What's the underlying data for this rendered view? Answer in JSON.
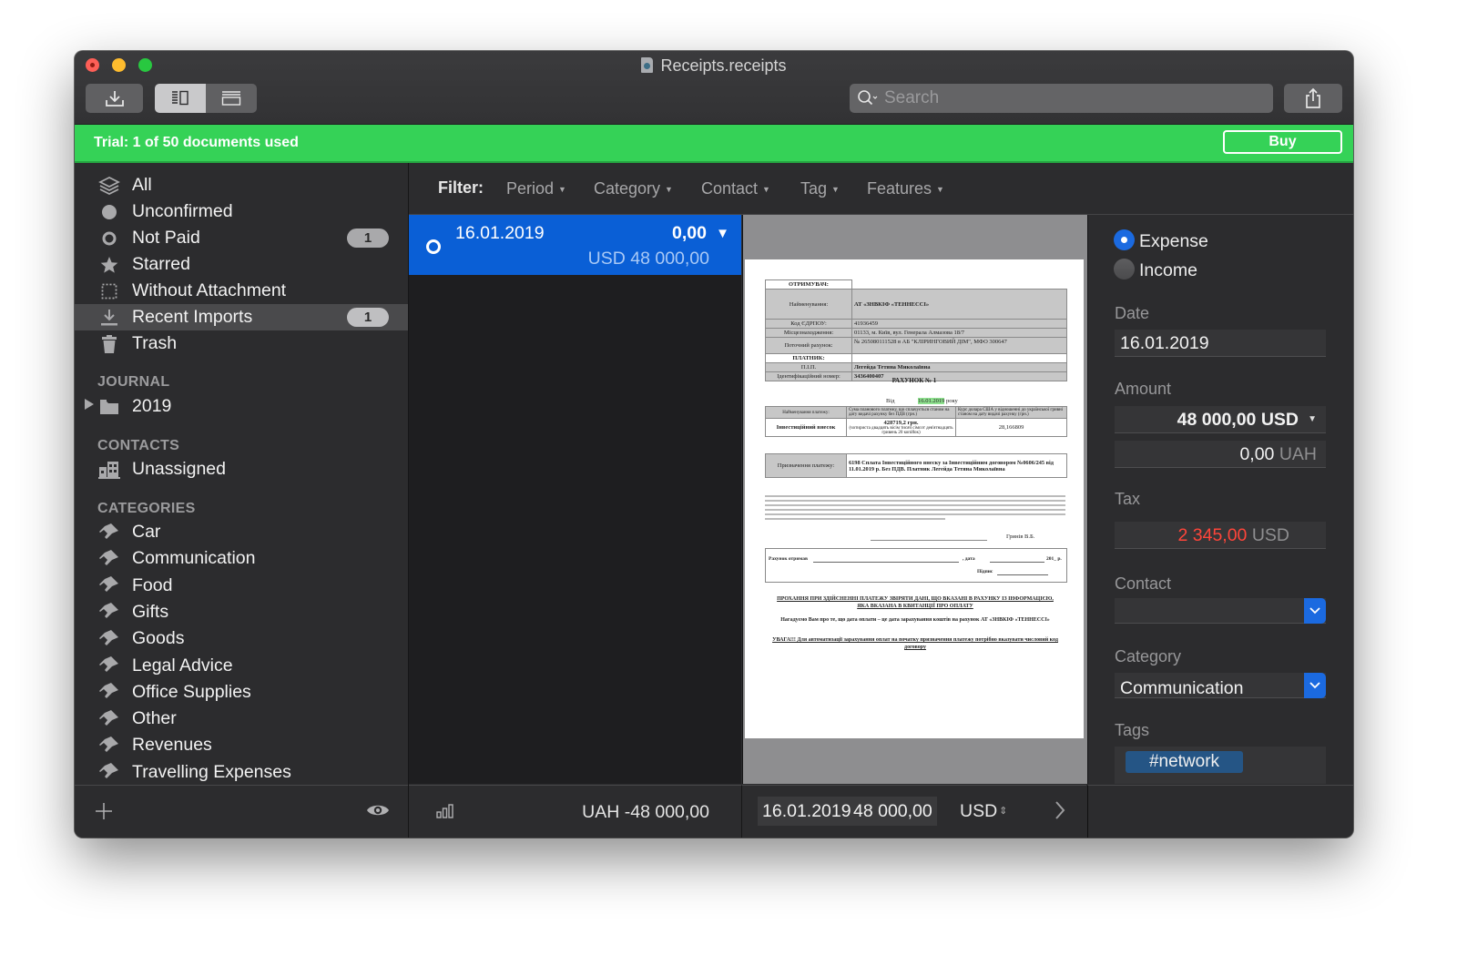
{
  "window": {
    "title": "Receipts.receipts",
    "file_icon": "receipts-document-icon"
  },
  "toolbar": {
    "import_icon": "import-icon",
    "view_modes": [
      {
        "name": "split-view-icon",
        "selected": true
      },
      {
        "name": "list-view-icon",
        "selected": false
      }
    ],
    "search_placeholder": "Search",
    "search_value": "",
    "share_icon": "share-icon"
  },
  "trial": {
    "text": "Trial: 1 of 50 documents used",
    "buy_label": "Buy",
    "color": "#35d257"
  },
  "sidebar": {
    "smart_items": [
      {
        "label": "All",
        "icon": "stack-icon",
        "badge": null,
        "selected": false
      },
      {
        "label": "Unconfirmed",
        "icon": "filled-circle-icon",
        "badge": null,
        "selected": false
      },
      {
        "label": "Not Paid",
        "icon": "open-circle-icon",
        "badge": "1",
        "selected": false
      },
      {
        "label": "Starred",
        "icon": "star-icon",
        "badge": null,
        "selected": false
      },
      {
        "label": "Without Attachment",
        "icon": "dotted-square-icon",
        "badge": null,
        "selected": false
      },
      {
        "label": "Recent Imports",
        "icon": "download-icon",
        "badge": "1",
        "selected": true
      },
      {
        "label": "Trash",
        "icon": "trash-icon",
        "badge": null,
        "selected": false
      }
    ],
    "journal_header": "JOURNAL",
    "journal_items": [
      {
        "label": "2019",
        "icon": "folder-icon",
        "expandable": true
      }
    ],
    "contacts_header": "CONTACTS",
    "contact_items": [
      {
        "label": "Unassigned",
        "icon": "building-icon"
      }
    ],
    "categories_header": "CATEGORIES",
    "categories": [
      "Car",
      "Communication",
      "Food",
      "Gifts",
      "Goods",
      "Legal Advice",
      "Office Supplies",
      "Other",
      "Revenues",
      "Travelling Expenses"
    ],
    "footer": {
      "add_icon": "plus-icon",
      "visibility_icon": "eye-icon"
    }
  },
  "filter": {
    "label": "Filter:",
    "items": [
      "Period",
      "Category",
      "Contact",
      "Tag",
      "Features"
    ]
  },
  "list": {
    "rows": [
      {
        "status": "not-paid",
        "date": "16.01.2019",
        "amount": "0,00",
        "original_amount": "USD 48 000,00",
        "selected": true
      }
    ],
    "total": "UAH -48 000,00",
    "stats_icon": "bar-chart-icon"
  },
  "preview_footer": {
    "date": "16.01.2019",
    "amount": "48 000,00",
    "currency": "USD",
    "next_icon": "chevron-right-icon"
  },
  "document": {
    "recipient_header": "ОТРИМУВАЧ:",
    "rows_recipient": [
      {
        "label": "Найменування:",
        "value": "АТ «ЗНВКІФ «ТЕННЕССІ»"
      },
      {
        "label": "Код ЄДРПОУ:",
        "value": "41936459"
      },
      {
        "label": "Місцезнаходження:",
        "value": "01133, м. Київ, вул. Генерала Алмазова 18/7"
      },
      {
        "label": "Поточний рахунок:",
        "value": "№ 265080111528 в АБ \"КЛІРИНГОВИЙ ДІМ\", МФО 300647"
      }
    ],
    "payer_header": "ПЛАТНИК:",
    "rows_payer": [
      {
        "label": "П.І.П.",
        "value": "Легейда Тетяна Миколаївна"
      },
      {
        "label": "Ідентифікаційний номер:",
        "value": "3436400407"
      }
    ],
    "invoice_title": "РАХУНОК № 1",
    "from_label": "Від",
    "from_date": "16.01.2019",
    "from_suffix": "року",
    "pay_table": {
      "headers": [
        "Найменування платежу:",
        "Сума планового платежу, що сплачується станом на дату видачі рахунку без ПДВ (грн.)",
        "Курс долара США у відношенні до української гривні станом на дату видачі рахунку (грн.)"
      ],
      "row": [
        "Інвестиційний внесок",
        "428719,2 грн.",
        "28,166809"
      ],
      "amount_words": "(чотириста двадцять вісім тисяч сімсот дев'ятнадцять гривень 20 копійок)"
    },
    "purpose_label": "Призначення платежу:",
    "purpose_value": "6198 Сплата Інвестиційного внеску за Інвестиційним договором №0606/245 від 11.01.2019 р. Без ПДВ. Платник Легейда Тетяна Миколаївна",
    "signatory": "Гринів В.Б.",
    "received_label": "Рахунок отримав",
    "date_label": ", дата",
    "year_suffix": "201_ р.",
    "sign_label": "Підпис",
    "notice_1": "ПРОХАННЯ ПРИ ЗДІЙСНЕННІ ПЛАТЕЖУ ЗВІРЯТИ ДАНІ, ЩО ВКАЗАНІ В РАХУНКУ ІЗ ІНФОРМАЦІЄЮ, ЯКА ВКАЗАНА В КВИТАНЦІЇ ПРО ОПЛАТУ",
    "notice_2": "Нагадуємо Вам про те, що дата оплати – це дата зарахування коштів на рахунок АТ «ЗНВКІФ «ТЕННЕССІ»",
    "notice_3": "УВАГА!!! Для автоматизації зарахування оплат на початку призначення платежу потрібно вказувати числовий код договору"
  },
  "inspector": {
    "type_options": [
      {
        "label": "Expense",
        "selected": true
      },
      {
        "label": "Income",
        "selected": false
      }
    ],
    "date_label": "Date",
    "date_value": "16.01.2019",
    "amount_label": "Amount",
    "amount_value": "48 000,00 USD",
    "converted_value": "0,00",
    "converted_currency": "UAH",
    "tax_label": "Tax",
    "tax_value": "2 345,00",
    "tax_currency": "USD",
    "tax_color": "#ff453a",
    "contact_label": "Contact",
    "contact_value": "",
    "category_label": "Category",
    "category_value": "Communication",
    "tags_label": "Tags",
    "tags": [
      "#network"
    ]
  }
}
